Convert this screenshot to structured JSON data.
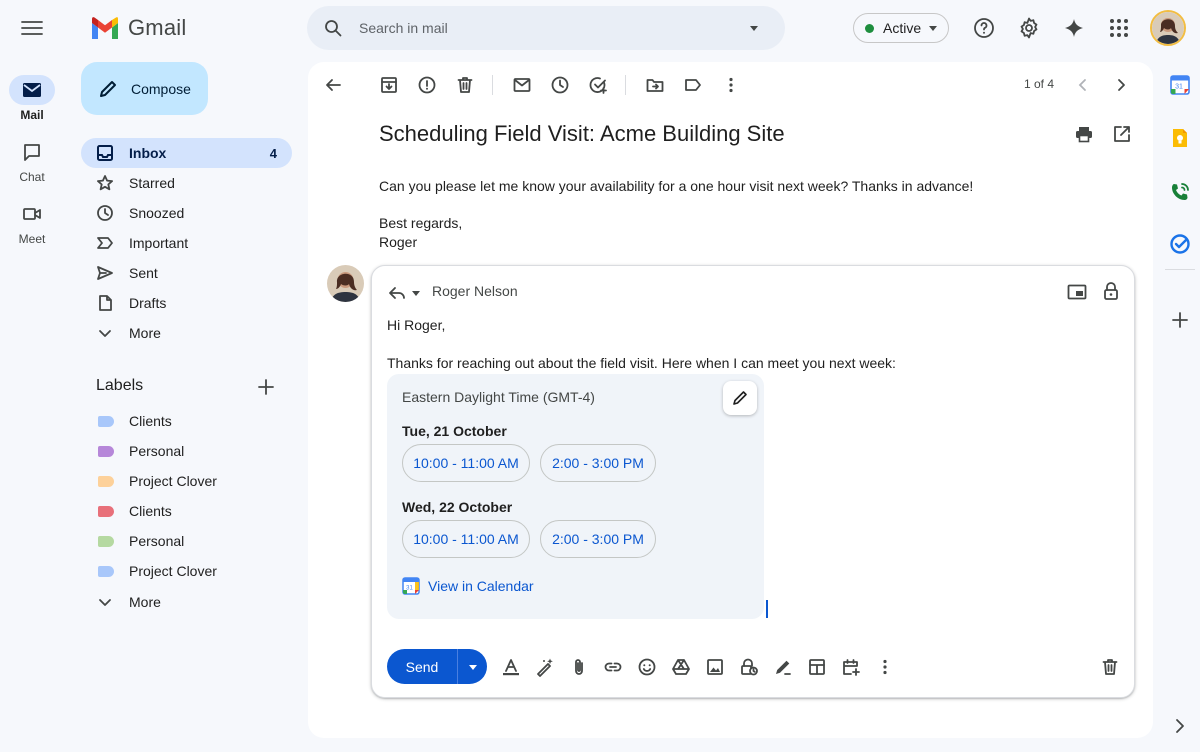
{
  "app": {
    "name": "Gmail"
  },
  "rail": {
    "items": [
      {
        "label": "Mail"
      },
      {
        "label": "Chat"
      },
      {
        "label": "Meet"
      }
    ]
  },
  "compose": {
    "label": "Compose"
  },
  "nav": {
    "items": [
      {
        "label": "Inbox",
        "count": "4"
      },
      {
        "label": "Starred"
      },
      {
        "label": "Snoozed"
      },
      {
        "label": "Important"
      },
      {
        "label": "Sent"
      },
      {
        "label": "Drafts"
      },
      {
        "label": "More"
      }
    ]
  },
  "labels": {
    "title": "Labels",
    "items": [
      {
        "label": "Clients",
        "color": "#a8c7fa"
      },
      {
        "label": "Personal",
        "color": "#b687d9"
      },
      {
        "label": "Project Clover",
        "color": "#fdd19a"
      },
      {
        "label": "Clients",
        "color": "#e8707a"
      },
      {
        "label": "Personal",
        "color": "#b5d9a1"
      },
      {
        "label": "Project Clover",
        "color": "#a8c7fa"
      }
    ],
    "more": "More"
  },
  "search": {
    "placeholder": "Search in mail"
  },
  "status": {
    "label": "Active",
    "color": "#1e8e3e"
  },
  "toolbar": {
    "pager": "1 of 4"
  },
  "email": {
    "subject": "Scheduling Field Visit: Acme Building Site",
    "body_line1": "Can you please let me know your availability for a one hour visit next week? Thanks in advance!",
    "body_line2": "Best regards,",
    "body_line3": "Roger"
  },
  "reply": {
    "recipient": "Roger Nelson",
    "greeting": "Hi Roger,",
    "intro": "Thanks for reaching out about the field visit. Here when I can meet you next week:",
    "timezone": "Eastern Daylight Time (GMT-4)",
    "days": [
      {
        "label": "Tue, 21 October",
        "slots": [
          "10:00 - 11:00 AM",
          "2:00 - 3:00 PM"
        ]
      },
      {
        "label": "Wed, 22 October",
        "slots": [
          "10:00 - 11:00 AM",
          "2:00 - 3:00 PM"
        ]
      }
    ],
    "calendar_link": "View in Calendar",
    "send_label": "Send"
  },
  "colors": {
    "accent": "#0b57d0",
    "compose_bg": "#c2e7ff",
    "inbox_active": "#d3e3fd"
  }
}
